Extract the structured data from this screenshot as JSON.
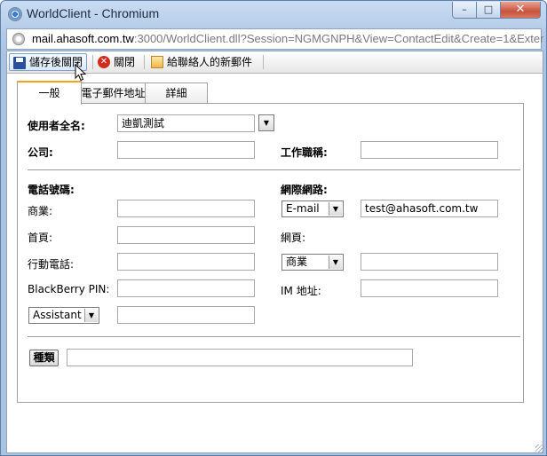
{
  "window": {
    "title": "WorldClient - Chromium",
    "minimize_glyph": "–",
    "maximize_glyph": "□",
    "close_glyph": "✕"
  },
  "address": {
    "url_host": "mail.ahasoft.com.tw",
    "url_rest": ":3000/WorldClient.dll?Session=NGMGNPH&View=ContactEdit&Create=1&Exter"
  },
  "toolbar": {
    "save_close": "儲存後關閉",
    "close": "關閉",
    "new_mail": "給聯絡人的新郵件"
  },
  "tabs": [
    {
      "label": "一般",
      "active": true
    },
    {
      "label": "電子郵件地址",
      "active": false
    },
    {
      "label": "詳細",
      "active": false
    }
  ],
  "form": {
    "fullname_label": "使用者全名:",
    "fullname_value": "迪凱測試",
    "company_label": "公司:",
    "company_value": "",
    "jobtitle_label": "工作職稱:",
    "jobtitle_value": "",
    "phone_header": "電話號碼:",
    "internet_header": "網際網路:",
    "business_label": "商業:",
    "business_value": "",
    "home_label": "首頁:",
    "home_value": "",
    "mobile_label": "行動電話:",
    "mobile_value": "",
    "blackberry_label": "BlackBerry PIN:",
    "blackberry_value": "",
    "assistant_select": "Assistant",
    "assistant_value": "",
    "email_select": "E-mail",
    "email_value": "test@ahasoft.com.tw",
    "webpage_label": "網頁:",
    "webpage_select": "商業",
    "webpage_value": "",
    "im_label": "IM 地址:",
    "im_value": "",
    "category_button": "種類",
    "category_value": ""
  }
}
